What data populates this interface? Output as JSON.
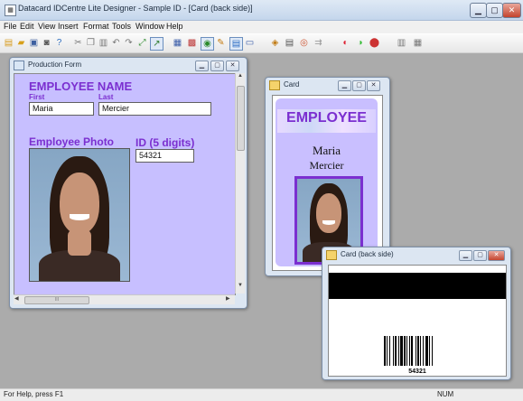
{
  "app": {
    "title": "Datacard IDCentre Lite Designer - Sample ID - [Card (back side)]",
    "icon": "app-icon",
    "caption_buttons": [
      "minimize",
      "maximize",
      "close"
    ]
  },
  "menubar": {
    "items": [
      "File",
      "Edit",
      "View",
      "Insert",
      "Format",
      "Tools",
      "Window",
      "Help"
    ]
  },
  "toolbar": {
    "icons": [
      "new-icon",
      "open-icon",
      "save-icon",
      "print-setup-icon",
      "help-icon",
      "cut-icon",
      "copy-icon",
      "paste-icon",
      "undo-icon",
      "redo-icon",
      "zoom-fit-icon",
      "chart-icon",
      "design-icon",
      "data-icon",
      "photo-icon",
      "grid-icon",
      "layout-icon",
      "card-icon",
      "db-icon",
      "table-icon",
      "batch-icon",
      "print-icon",
      "encode-icon",
      "settings-icon",
      "magstripe-icon",
      "export-icon"
    ]
  },
  "production_form": {
    "title": "Production Form",
    "heading": "EMPLOYEE NAME",
    "first_label": "First",
    "last_label": "Last",
    "first_value": "Maria",
    "last_value": "Mercier",
    "photo_label": "Employee Photo",
    "id_label": "ID (5 digits)",
    "id_value": "54321",
    "hscroll_grip": "III"
  },
  "card_front": {
    "title": "Card",
    "heading": "EMPLOYEE",
    "first_name": "Maria",
    "last_name": "Mercier"
  },
  "card_back": {
    "title": "Card (back side)",
    "barcode_number": "54321"
  },
  "status": {
    "help_text": "For Help, press F1",
    "num_indicator": "NUM"
  },
  "colors": {
    "accent_purple": "#7b2fd0",
    "form_background": "#c7bfff",
    "mdi_background": "#ababab",
    "magstripe": "#000000"
  }
}
